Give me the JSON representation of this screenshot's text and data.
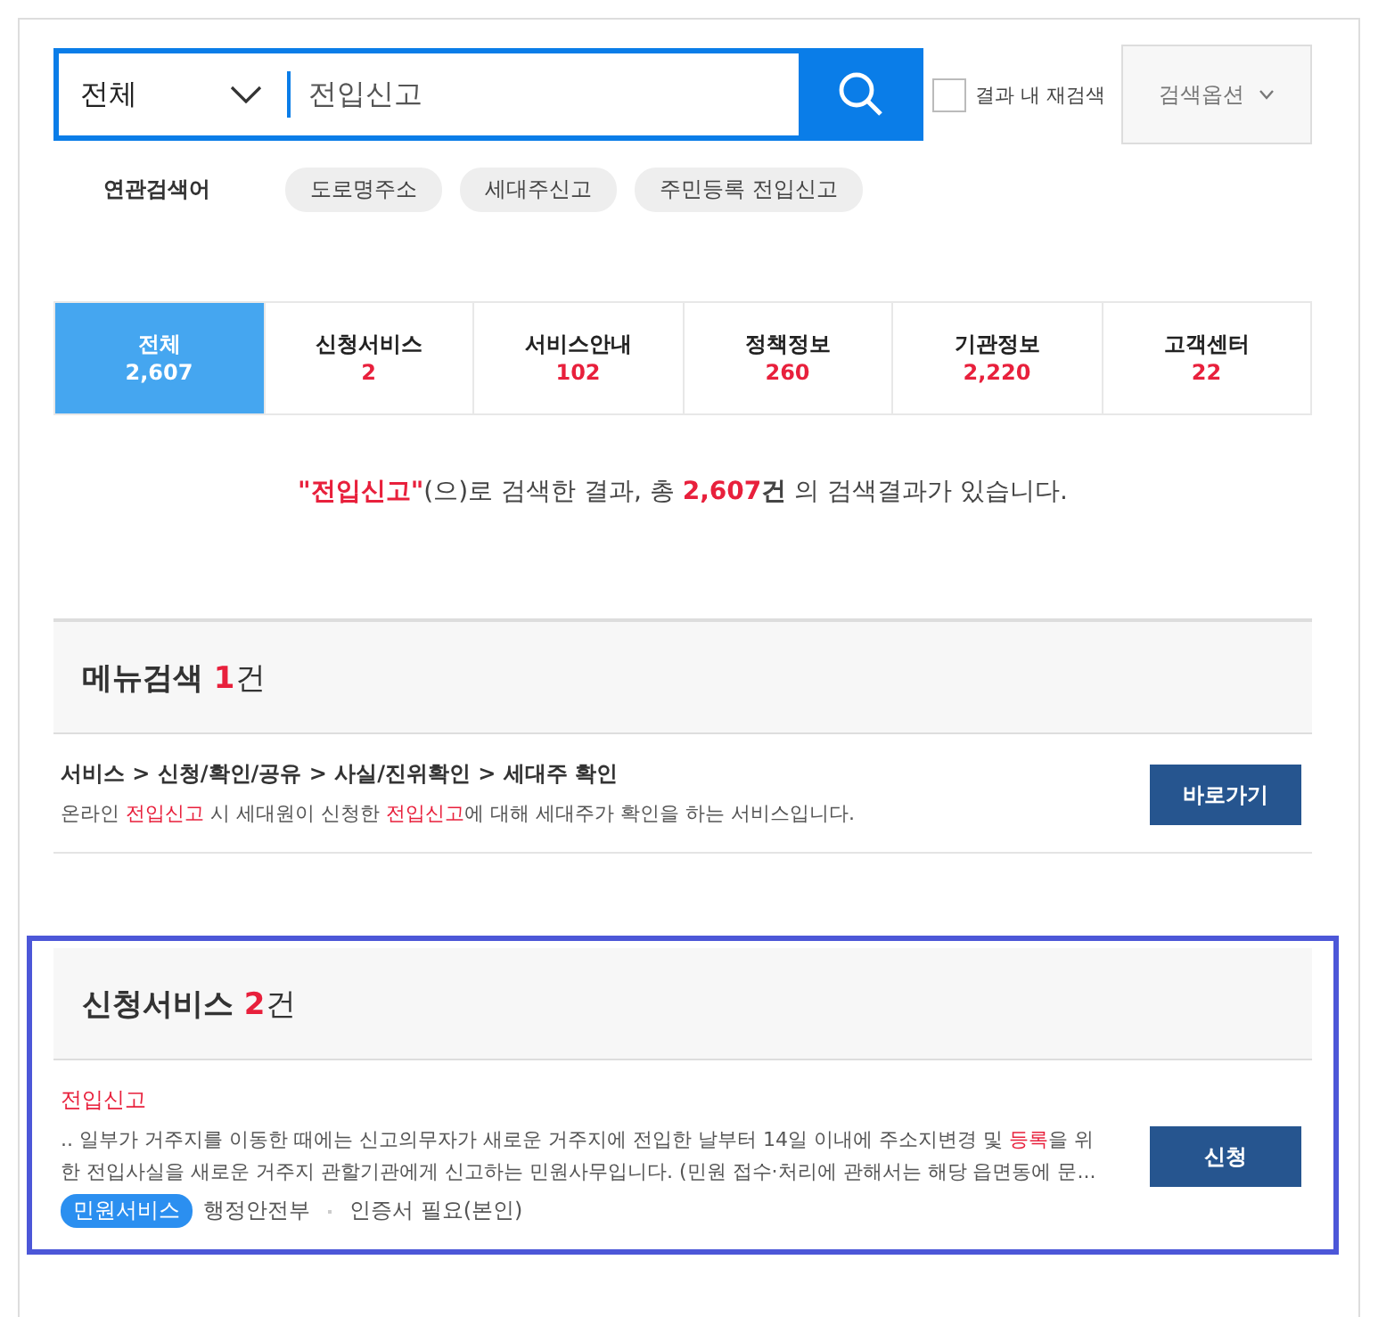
{
  "search": {
    "scope": "전체",
    "query": "전입신고",
    "refine": {
      "label": "결과 내 재검색",
      "checked": false
    },
    "options_button": "검색옵션"
  },
  "related": {
    "label": "연관검색어",
    "keywords": [
      "도로명주소",
      "세대주신고",
      "주민등록 전입신고"
    ]
  },
  "tabs": [
    {
      "label": "전체",
      "count": "2,607",
      "selected": true
    },
    {
      "label": "신청서비스",
      "count": "2",
      "selected": false
    },
    {
      "label": "서비스안내",
      "count": "102",
      "selected": false
    },
    {
      "label": "정책정보",
      "count": "260",
      "selected": false
    },
    {
      "label": "기관정보",
      "count": "2,220",
      "selected": false
    },
    {
      "label": "고객센터",
      "count": "22",
      "selected": false
    }
  ],
  "summary": [
    {
      "text": "\"전입신고\"",
      "hl": true,
      "bold": true
    },
    {
      "text": "(으)로 검색한 결과, 총 ",
      "hl": false,
      "bold": false
    },
    {
      "text": "2,607",
      "hl": true,
      "bold": true
    },
    {
      "text": "건",
      "hl": false,
      "bold": true
    },
    {
      "text": " 의 검색결과가 있습니다.",
      "hl": false,
      "bold": false
    }
  ],
  "sections": [
    {
      "title": "메뉴검색",
      "count": "1",
      "unit": "건",
      "highlighted": false,
      "items": [
        {
          "kind": "menu",
          "title": "서비스 > 신청/확인/공유 > 사실/진위확인 > 세대주 확인",
          "desc": [
            {
              "text": "온라인 ",
              "hl": false
            },
            {
              "text": "전입신고",
              "hl": true
            },
            {
              "text": " 시 세대원이 신청한 ",
              "hl": false
            },
            {
              "text": "전입신고",
              "hl": true
            },
            {
              "text": "에 대해 세대주가 확인을 하는 서비스입니다.",
              "hl": false
            }
          ],
          "button": "바로가기"
        }
      ]
    },
    {
      "title": "신청서비스",
      "count": "2",
      "unit": "건",
      "highlighted": true,
      "items": [
        {
          "kind": "service",
          "title": "전입신고",
          "desc": [
            {
              "text": ".. 일부가 거주지를 이동한 때에는 신고의무자가 새로운 거주지에 전입한 날부터 14일 이내에 주소지변경 및 ",
              "hl": false
            },
            {
              "text": "등록",
              "hl": true
            },
            {
              "text": "을 위한 전입사실을 새로운 거주지 관할기관에게 신고하는 민원사무입니다. (민원 접수·처리에 관해서는 해당 읍면동에 문...",
              "hl": false
            }
          ],
          "tag": "민원서비스",
          "meta": [
            "행정안전부",
            "인증서 필요(본인)"
          ],
          "button": "신청"
        }
      ]
    }
  ]
}
